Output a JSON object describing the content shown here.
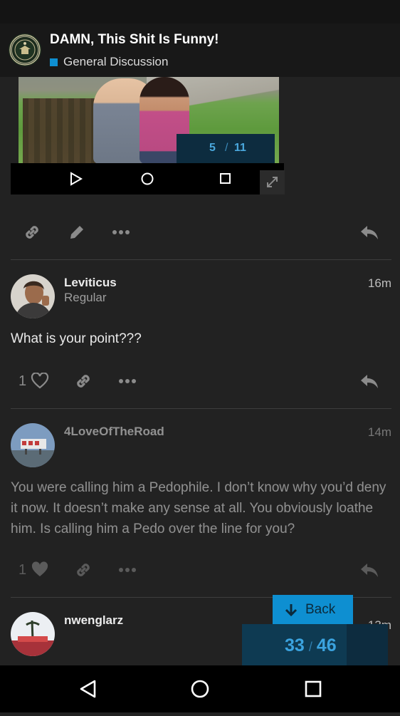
{
  "header": {
    "title": "DAMN, This Shit Is Funny!",
    "category": "General Discussion",
    "category_color": "#0e8fd1"
  },
  "image_post": {
    "lightbox_counter_current": "5",
    "lightbox_counter_total": "11"
  },
  "posts": [
    {
      "username": "Leviticus",
      "user_title": "Regular",
      "time": "16m",
      "body": "What is your point???",
      "likes": "1"
    },
    {
      "username": "4LoveOfTheRoad",
      "time": "14m",
      "body": "You were calling him a Pedophile. I don’t know why you’d deny it now. It doesn’t make any sense at all. You obviously loathe him. Is calling him a Pedo over the line for you?",
      "likes": "1"
    },
    {
      "username": "nwenglarz",
      "time": "13m"
    }
  ],
  "timeline": {
    "back_label": "Back",
    "current": "33",
    "total": "46",
    "fraction": 0.7174
  },
  "icons": {
    "link": "link-icon",
    "edit": "pencil-icon",
    "more": "more-icon",
    "reply": "reply-icon",
    "like": "heart-icon",
    "back": "arrow-down-icon",
    "expand": "expand-icon",
    "nav_back": "triangle-back-icon",
    "nav_home": "circle-home-icon",
    "nav_recents": "square-recents-icon"
  }
}
